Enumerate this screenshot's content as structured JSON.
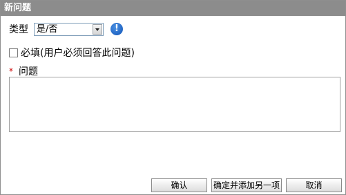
{
  "dialog": {
    "title": "新问题",
    "type_label": "类型",
    "type_select_value": "是/否",
    "info_icon_glyph": "!",
    "required_label": "必填(用户必须回答此问题)",
    "required_star": "*",
    "question_label": "问题",
    "question_value": ""
  },
  "buttons": {
    "confirm": "确认",
    "confirm_add": "确定并添加另一项",
    "cancel": "取消"
  }
}
